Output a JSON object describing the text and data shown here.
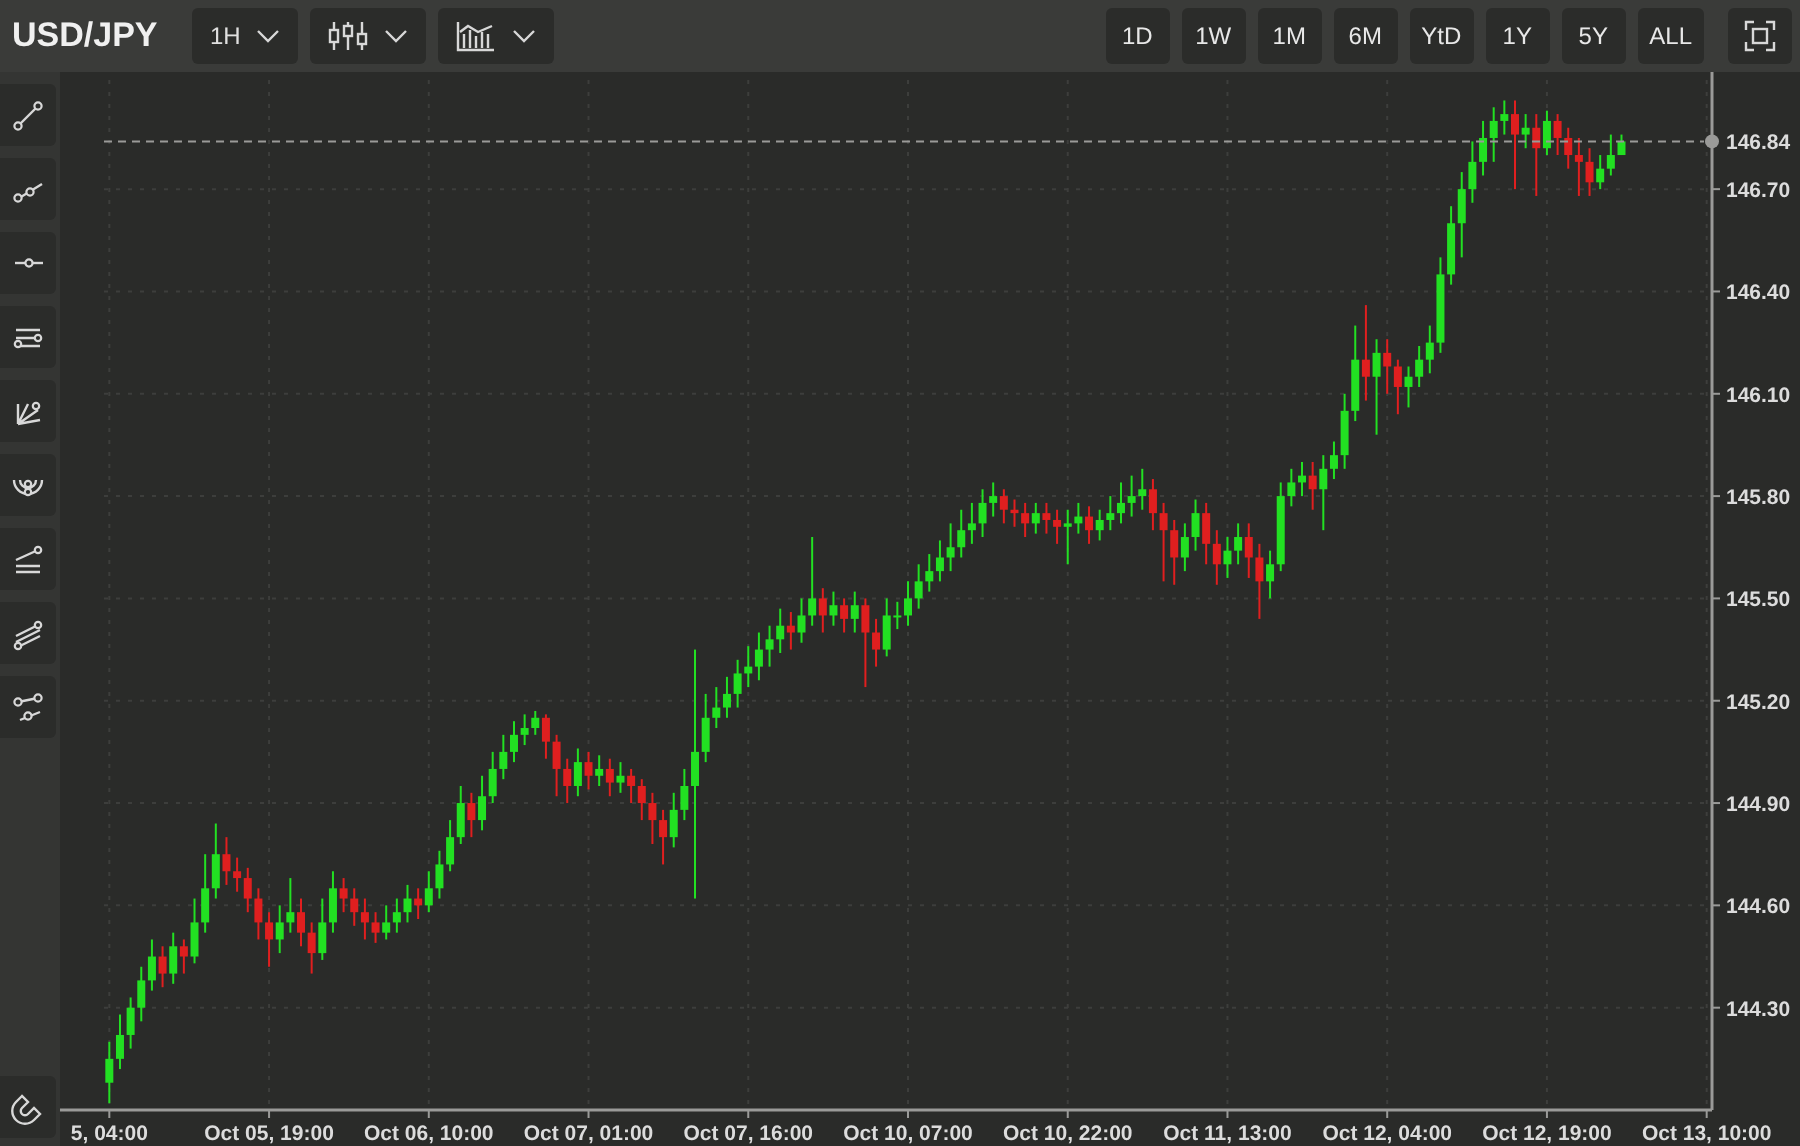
{
  "symbol": "USD/JPY",
  "dropdowns": [
    {
      "kind": "interval",
      "label": "1H"
    },
    {
      "kind": "candles"
    },
    {
      "kind": "indicators"
    }
  ],
  "ranges": [
    {
      "label": "1D",
      "selected": false
    },
    {
      "label": "1W",
      "selected": false
    },
    {
      "label": "1M",
      "selected": false
    },
    {
      "label": "6M",
      "selected": false
    },
    {
      "label": "YtD",
      "selected": false
    },
    {
      "label": "1Y",
      "selected": false
    },
    {
      "label": "5Y",
      "selected": false
    },
    {
      "label": "ALL",
      "selected": false
    }
  ],
  "chart_data": {
    "type": "candlestick",
    "grid": true,
    "ylim": [
      144.0,
      147.02
    ],
    "yticks": [
      {
        "value": 146.7,
        "label": "146.70"
      },
      {
        "value": 146.4,
        "label": "146.40"
      },
      {
        "value": 146.1,
        "label": "146.10"
      },
      {
        "value": 145.8,
        "label": "145.80"
      },
      {
        "value": 145.5,
        "label": "145.50"
      },
      {
        "value": 145.2,
        "label": "145.20"
      },
      {
        "value": 144.9,
        "label": "144.90"
      },
      {
        "value": 144.6,
        "label": "144.60"
      },
      {
        "value": 144.3,
        "label": "144.30"
      }
    ],
    "categories": [
      "5, 04:00",
      null,
      null,
      null,
      null,
      null,
      null,
      null,
      null,
      null,
      null,
      null,
      null,
      null,
      null,
      "Oct 05, 19:00",
      null,
      null,
      null,
      null,
      null,
      null,
      null,
      null,
      null,
      null,
      null,
      null,
      null,
      null,
      "Oct 06, 10:00",
      null,
      null,
      null,
      null,
      null,
      null,
      null,
      null,
      null,
      null,
      null,
      null,
      null,
      null,
      "Oct 07, 01:00",
      null,
      null,
      null,
      null,
      null,
      null,
      null,
      null,
      null,
      null,
      null,
      null,
      null,
      null,
      "Oct 07, 16:00",
      null,
      null,
      null,
      null,
      null,
      null,
      null,
      null,
      null,
      null,
      null,
      null,
      null,
      null,
      "Oct 10, 07:00",
      null,
      null,
      null,
      null,
      null,
      null,
      null,
      null,
      null,
      null,
      null,
      null,
      null,
      null,
      "Oct 10, 22:00",
      null,
      null,
      null,
      null,
      null,
      null,
      null,
      null,
      null,
      null,
      null,
      null,
      null,
      null,
      "Oct 11, 13:00",
      null,
      null,
      null,
      null,
      null,
      null,
      null,
      null,
      null,
      null,
      null,
      null,
      null,
      null,
      "Oct 12, 04:00",
      null,
      null,
      null,
      null,
      null,
      null,
      null,
      null,
      null,
      null,
      null,
      null,
      null,
      null,
      "Oct 12, 19:00",
      null,
      null,
      null,
      null,
      null,
      null,
      null,
      null,
      null,
      null,
      null,
      null,
      null,
      null,
      "Oct 13, 10:00"
    ],
    "ohlc": [
      [
        144.08,
        144.2,
        144.02,
        144.15
      ],
      [
        144.15,
        144.28,
        144.12,
        144.22
      ],
      [
        144.22,
        144.33,
        144.18,
        144.3
      ],
      [
        144.3,
        144.42,
        144.26,
        144.38
      ],
      [
        144.38,
        144.5,
        144.35,
        144.45
      ],
      [
        144.45,
        144.48,
        144.36,
        144.4
      ],
      [
        144.4,
        144.52,
        144.37,
        144.48
      ],
      [
        144.48,
        144.5,
        144.4,
        144.45
      ],
      [
        144.45,
        144.62,
        144.43,
        144.55
      ],
      [
        144.55,
        144.75,
        144.52,
        144.65
      ],
      [
        144.65,
        144.84,
        144.62,
        144.75
      ],
      [
        144.75,
        144.8,
        144.66,
        144.7
      ],
      [
        144.7,
        144.74,
        144.64,
        144.68
      ],
      [
        144.68,
        144.71,
        144.58,
        144.62
      ],
      [
        144.62,
        144.65,
        144.5,
        144.55
      ],
      [
        144.55,
        144.58,
        144.42,
        144.5
      ],
      [
        144.5,
        144.6,
        144.46,
        144.55
      ],
      [
        144.55,
        144.68,
        144.52,
        144.58
      ],
      [
        144.58,
        144.62,
        144.48,
        144.52
      ],
      [
        144.52,
        144.55,
        144.4,
        144.46
      ],
      [
        144.46,
        144.62,
        144.44,
        144.55
      ],
      [
        144.55,
        144.7,
        144.52,
        144.65
      ],
      [
        144.65,
        144.68,
        144.58,
        144.62
      ],
      [
        144.62,
        144.65,
        144.54,
        144.58
      ],
      [
        144.58,
        144.62,
        144.5,
        144.55
      ],
      [
        144.55,
        144.58,
        144.49,
        144.52
      ],
      [
        144.52,
        144.6,
        144.5,
        144.55
      ],
      [
        144.55,
        144.62,
        144.52,
        144.58
      ],
      [
        144.58,
        144.66,
        144.55,
        144.62
      ],
      [
        144.62,
        144.65,
        144.56,
        144.6
      ],
      [
        144.6,
        144.7,
        144.58,
        144.65
      ],
      [
        144.65,
        144.76,
        144.62,
        144.72
      ],
      [
        144.72,
        144.85,
        144.7,
        144.8
      ],
      [
        144.8,
        144.95,
        144.78,
        144.9
      ],
      [
        144.9,
        144.93,
        144.8,
        144.85
      ],
      [
        144.85,
        144.98,
        144.82,
        144.92
      ],
      [
        144.92,
        145.05,
        144.9,
        145.0
      ],
      [
        145.0,
        145.1,
        144.97,
        145.05
      ],
      [
        145.05,
        145.14,
        145.02,
        145.1
      ],
      [
        145.1,
        145.16,
        145.07,
        145.12
      ],
      [
        145.12,
        145.17,
        145.1,
        145.15
      ],
      [
        145.15,
        145.16,
        145.03,
        145.08
      ],
      [
        145.08,
        145.1,
        144.92,
        145.0
      ],
      [
        145.0,
        145.03,
        144.9,
        144.95
      ],
      [
        144.95,
        145.06,
        144.92,
        145.02
      ],
      [
        145.02,
        145.05,
        144.94,
        144.98
      ],
      [
        144.98,
        145.04,
        144.95,
        145.0
      ],
      [
        145.0,
        145.03,
        144.92,
        144.96
      ],
      [
        144.96,
        145.02,
        144.93,
        144.98
      ],
      [
        144.98,
        145.0,
        144.9,
        144.95
      ],
      [
        144.95,
        144.97,
        144.85,
        144.9
      ],
      [
        144.9,
        144.93,
        144.78,
        144.85
      ],
      [
        144.85,
        144.88,
        144.72,
        144.8
      ],
      [
        144.8,
        144.93,
        144.77,
        144.88
      ],
      [
        144.88,
        145.0,
        144.85,
        144.95
      ],
      [
        144.95,
        145.35,
        144.62,
        145.05
      ],
      [
        145.05,
        145.22,
        145.02,
        145.15
      ],
      [
        145.15,
        145.24,
        145.12,
        145.18
      ],
      [
        145.18,
        145.27,
        145.15,
        145.22
      ],
      [
        145.22,
        145.32,
        145.18,
        145.28
      ],
      [
        145.28,
        145.36,
        145.24,
        145.3
      ],
      [
        145.3,
        145.4,
        145.26,
        145.35
      ],
      [
        145.35,
        145.42,
        145.3,
        145.38
      ],
      [
        145.38,
        145.47,
        145.34,
        145.42
      ],
      [
        145.42,
        145.46,
        145.35,
        145.4
      ],
      [
        145.4,
        145.5,
        145.37,
        145.45
      ],
      [
        145.45,
        145.68,
        145.42,
        145.5
      ],
      [
        145.5,
        145.53,
        145.4,
        145.45
      ],
      [
        145.45,
        145.52,
        145.42,
        145.48
      ],
      [
        145.48,
        145.5,
        145.4,
        145.44
      ],
      [
        145.44,
        145.52,
        145.4,
        145.48
      ],
      [
        145.48,
        145.5,
        145.24,
        145.4
      ],
      [
        145.4,
        145.44,
        145.3,
        145.35
      ],
      [
        145.35,
        145.5,
        145.33,
        145.45
      ],
      [
        145.45,
        145.49,
        145.41,
        145.45
      ],
      [
        145.45,
        145.55,
        145.42,
        145.5
      ],
      [
        145.5,
        145.6,
        145.47,
        145.55
      ],
      [
        145.55,
        145.63,
        145.52,
        145.58
      ],
      [
        145.58,
        145.67,
        145.55,
        145.62
      ],
      [
        145.62,
        145.72,
        145.58,
        145.65
      ],
      [
        145.65,
        145.76,
        145.62,
        145.7
      ],
      [
        145.7,
        145.78,
        145.66,
        145.72
      ],
      [
        145.72,
        145.82,
        145.68,
        145.78
      ],
      [
        145.78,
        145.84,
        145.74,
        145.8
      ],
      [
        145.8,
        145.82,
        145.72,
        145.76
      ],
      [
        145.76,
        145.79,
        145.71,
        145.75
      ],
      [
        145.75,
        145.78,
        145.68,
        145.72
      ],
      [
        145.72,
        145.78,
        145.69,
        145.75
      ],
      [
        145.75,
        145.78,
        145.69,
        145.73
      ],
      [
        145.73,
        145.76,
        145.66,
        145.71
      ],
      [
        145.71,
        145.76,
        145.6,
        145.72
      ],
      [
        145.72,
        145.78,
        145.69,
        145.74
      ],
      [
        145.74,
        145.77,
        145.66,
        145.7
      ],
      [
        145.7,
        145.76,
        145.67,
        145.73
      ],
      [
        145.73,
        145.8,
        145.7,
        145.75
      ],
      [
        145.75,
        145.84,
        145.72,
        145.78
      ],
      [
        145.78,
        145.86,
        145.74,
        145.8
      ],
      [
        145.8,
        145.88,
        145.76,
        145.82
      ],
      [
        145.82,
        145.85,
        145.7,
        145.75
      ],
      [
        145.75,
        145.78,
        145.55,
        145.7
      ],
      [
        145.7,
        145.73,
        145.54,
        145.62
      ],
      [
        145.62,
        145.72,
        145.58,
        145.68
      ],
      [
        145.68,
        145.79,
        145.64,
        145.75
      ],
      [
        145.75,
        145.78,
        145.6,
        145.66
      ],
      [
        145.66,
        145.7,
        145.54,
        145.6
      ],
      [
        145.6,
        145.68,
        145.56,
        145.64
      ],
      [
        145.64,
        145.72,
        145.6,
        145.68
      ],
      [
        145.68,
        145.72,
        145.56,
        145.62
      ],
      [
        145.62,
        145.66,
        145.44,
        145.55
      ],
      [
        145.55,
        145.64,
        145.5,
        145.6
      ],
      [
        145.6,
        145.84,
        145.58,
        145.8
      ],
      [
        145.8,
        145.88,
        145.77,
        145.84
      ],
      [
        145.84,
        145.9,
        145.8,
        145.86
      ],
      [
        145.86,
        145.9,
        145.76,
        145.82
      ],
      [
        145.82,
        145.92,
        145.7,
        145.88
      ],
      [
        145.88,
        145.96,
        145.85,
        145.92
      ],
      [
        145.92,
        146.1,
        145.88,
        146.05
      ],
      [
        146.05,
        146.3,
        146.02,
        146.2
      ],
      [
        146.2,
        146.36,
        146.08,
        146.15
      ],
      [
        146.15,
        146.26,
        145.98,
        146.22
      ],
      [
        146.22,
        146.26,
        146.1,
        146.18
      ],
      [
        146.18,
        146.2,
        146.04,
        146.12
      ],
      [
        146.12,
        146.18,
        146.06,
        146.15
      ],
      [
        146.15,
        146.24,
        146.12,
        146.2
      ],
      [
        146.2,
        146.3,
        146.16,
        146.25
      ],
      [
        146.25,
        146.5,
        146.22,
        146.45
      ],
      [
        146.45,
        146.65,
        146.42,
        146.6
      ],
      [
        146.6,
        146.75,
        146.5,
        146.7
      ],
      [
        146.7,
        146.84,
        146.66,
        146.78
      ],
      [
        146.78,
        146.9,
        146.74,
        146.85
      ],
      [
        146.85,
        146.94,
        146.78,
        146.9
      ],
      [
        146.9,
        146.96,
        146.86,
        146.92
      ],
      [
        146.92,
        146.96,
        146.7,
        146.86
      ],
      [
        146.86,
        146.92,
        146.82,
        146.88
      ],
      [
        146.88,
        146.92,
        146.68,
        146.82
      ],
      [
        146.82,
        146.93,
        146.8,
        146.9
      ],
      [
        146.9,
        146.92,
        146.8,
        146.85
      ],
      [
        146.85,
        146.88,
        146.76,
        146.8
      ],
      [
        146.8,
        146.85,
        146.68,
        146.78
      ],
      [
        146.78,
        146.82,
        146.68,
        146.72
      ],
      [
        146.72,
        146.8,
        146.7,
        146.76
      ],
      [
        146.76,
        146.86,
        146.74,
        146.8
      ],
      [
        146.8,
        146.86,
        146.8,
        146.84
      ],
      null,
      null,
      null,
      null,
      null,
      null,
      null,
      null
    ],
    "ref_lines": [
      {
        "axis": "y",
        "value": 146.84,
        "label": "146.84"
      }
    ]
  }
}
